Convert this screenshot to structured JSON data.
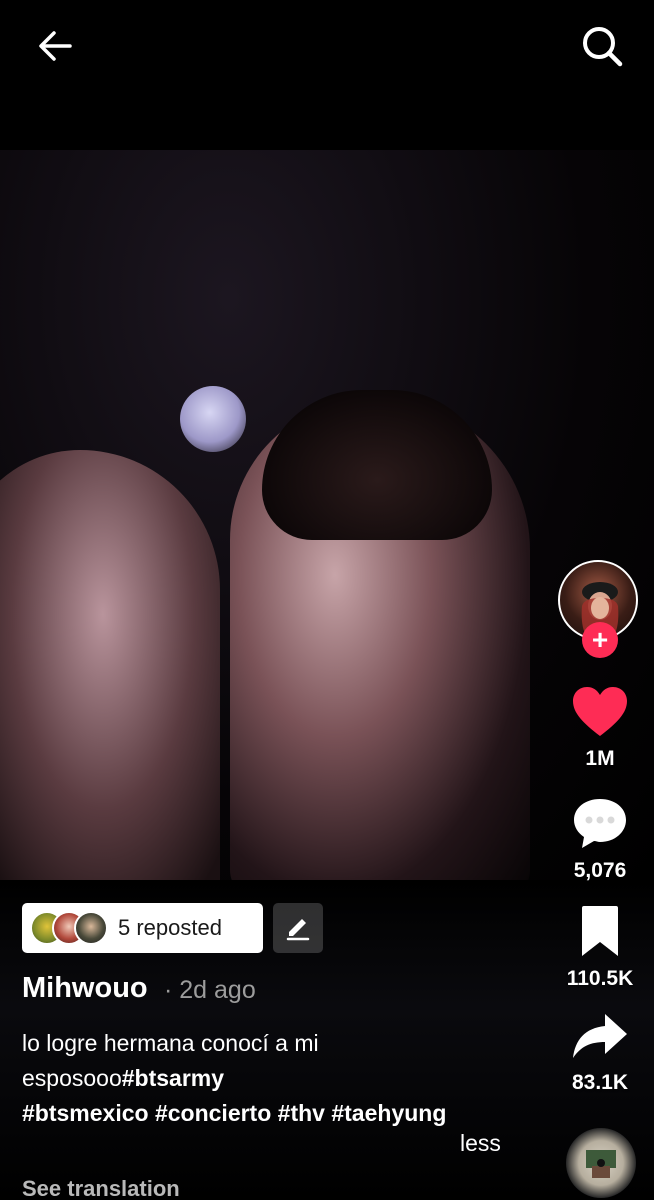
{
  "icons": {
    "back": "arrow-left-icon",
    "search": "search-icon",
    "like": "heart-icon",
    "comment": "comment-icon",
    "save": "bookmark-icon",
    "share": "share-icon",
    "edit": "pencil-icon",
    "follow": "plus-icon"
  },
  "colors": {
    "background": "#000000",
    "like": "#fe2c55",
    "follow_button": "#fe2c55",
    "text_primary": "#ffffff",
    "text_secondary": "#9c9c9c"
  },
  "follow": {
    "label": "+"
  },
  "actions": {
    "likes": "1M",
    "comments": "5,076",
    "saves": "110.5K",
    "shares": "83.1K"
  },
  "repost": {
    "label": "5 reposted"
  },
  "post": {
    "author": "Mihwouo",
    "time": "· 2d ago",
    "caption_text_1": "lo logre hermana conocí a mi",
    "caption_text_2": "esposooo",
    "hashtags": [
      "#btsarmy",
      "#btsmexico",
      "#concierto",
      "#thv",
      "#taehyung"
    ],
    "less_label": "less",
    "see_translation": "See translation"
  }
}
